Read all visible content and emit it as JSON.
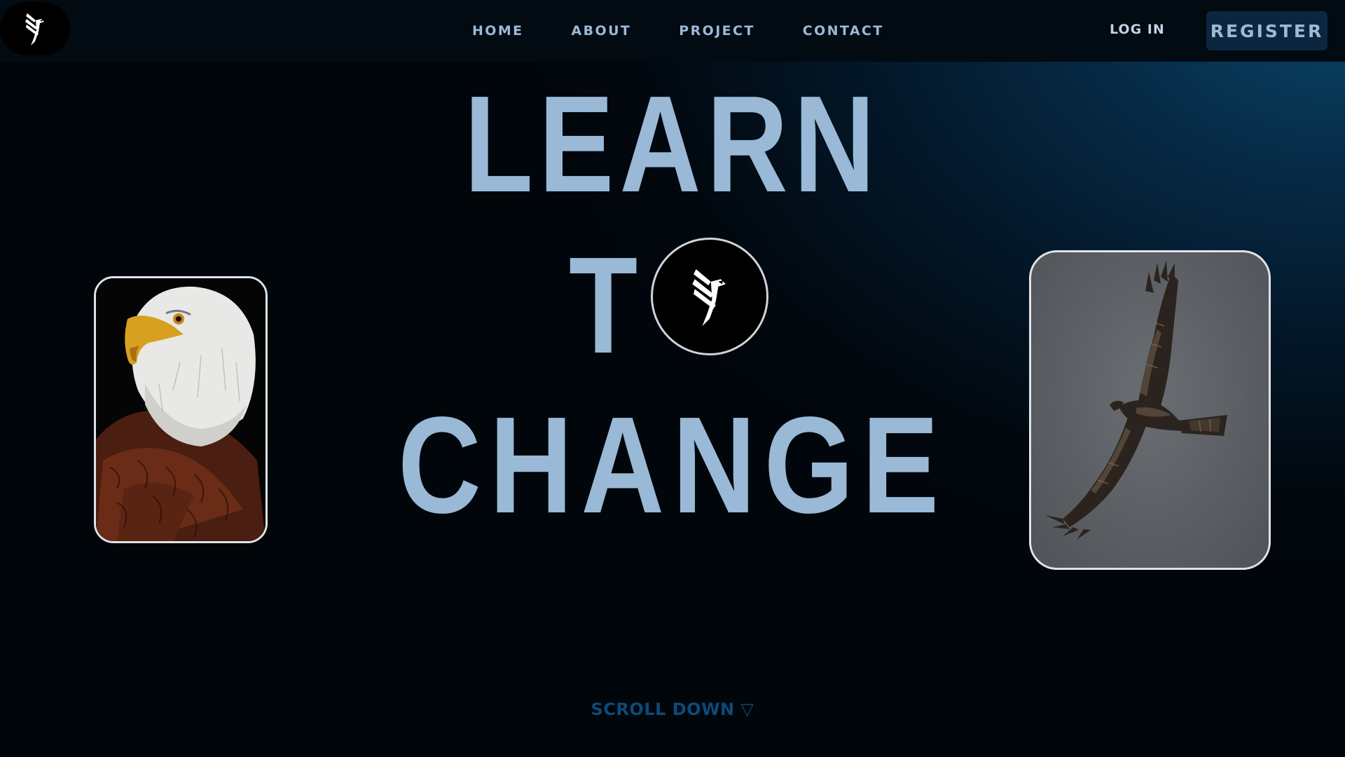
{
  "nav": {
    "links": [
      {
        "label": "HOME"
      },
      {
        "label": "ABOUT"
      },
      {
        "label": "PROJECT"
      },
      {
        "label": "CONTACT"
      }
    ],
    "login_label": "LOG IN",
    "register_label": "REGISTER",
    "logo_icon": "eagle-logo-icon"
  },
  "hero": {
    "line1": "LEARN",
    "line2_letter": "T",
    "line3": "CHANGE",
    "circle_icon": "eagle-logo-icon"
  },
  "images": {
    "left": "bald-eagle-portrait",
    "right": "soaring-hawk"
  },
  "scroll": {
    "label": "SCROLL DOWN ▽"
  },
  "colors": {
    "accent_text": "#99b9d6",
    "nav_bg": "#020a12",
    "register_bg": "#0d2640",
    "scroll_text": "#0d4a78"
  }
}
